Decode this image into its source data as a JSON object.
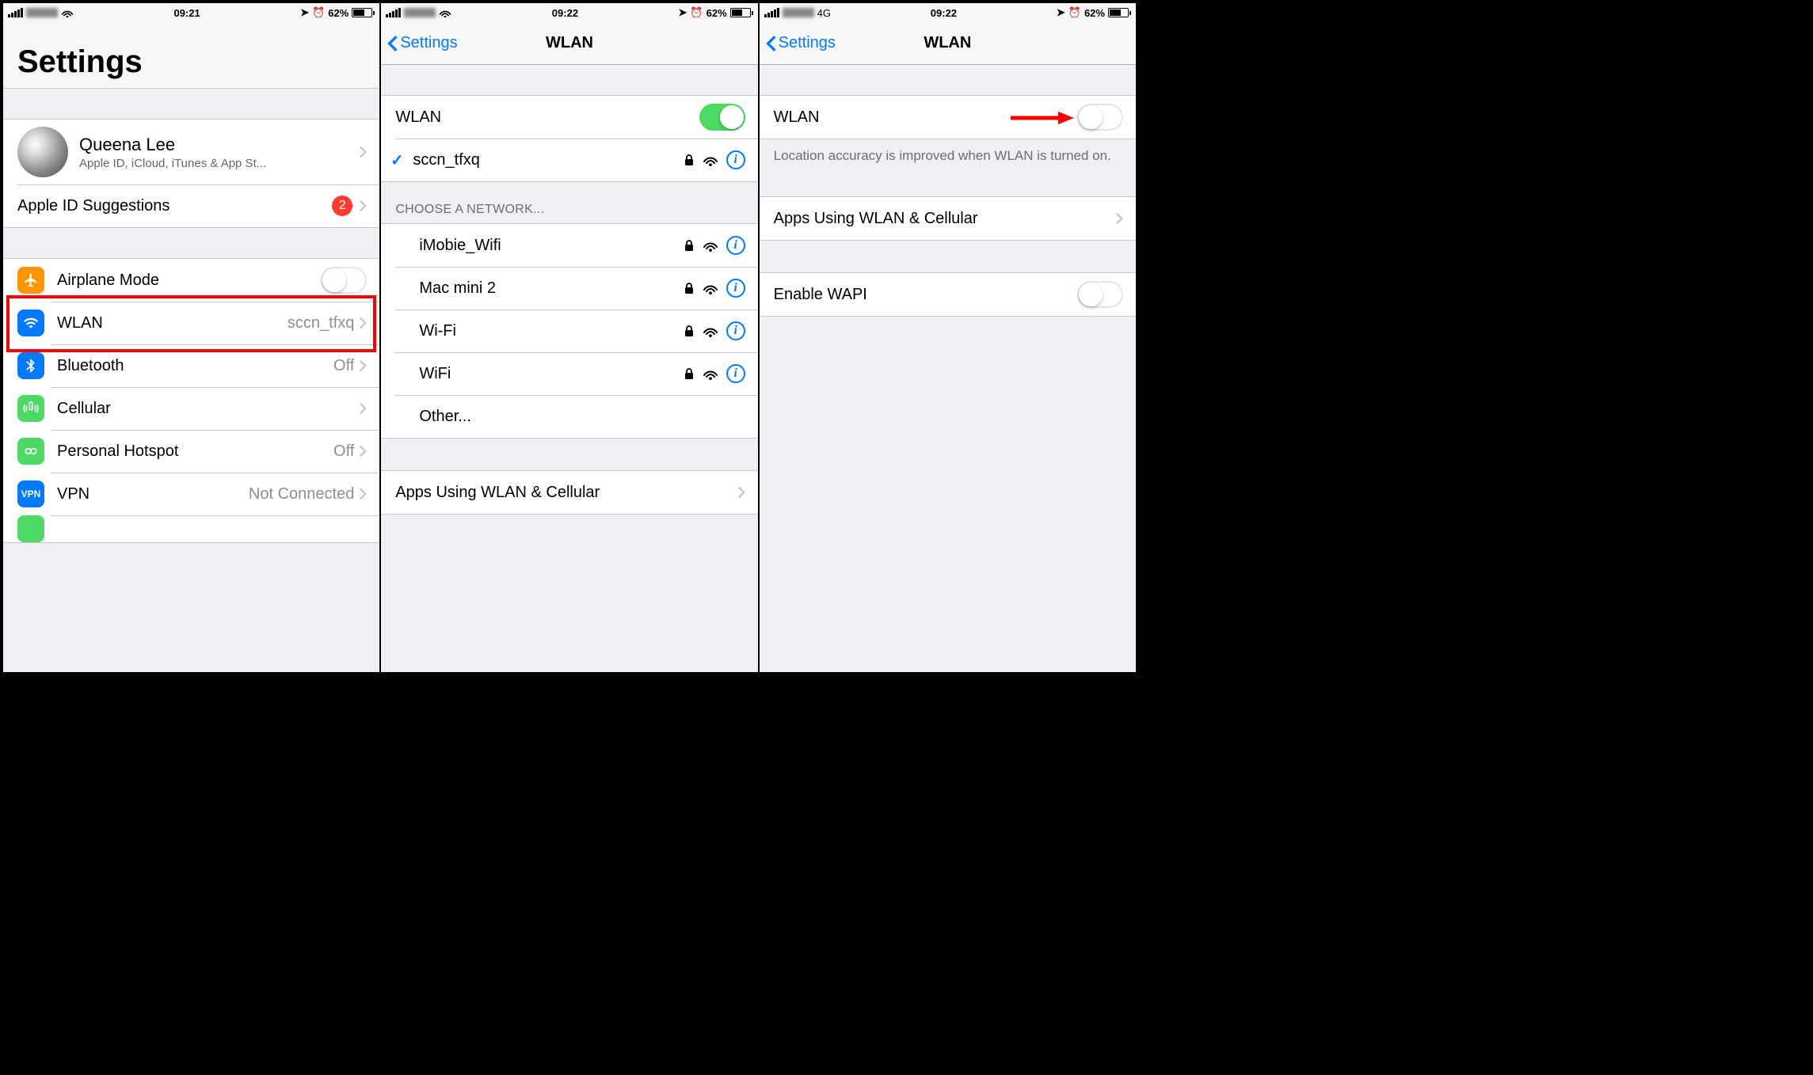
{
  "screen1": {
    "status": {
      "time": "09:21",
      "battery_pct": "62%"
    },
    "title": "Settings",
    "profile": {
      "name": "Queena Lee",
      "subtitle": "Apple ID, iCloud, iTunes & App St..."
    },
    "apple_id_suggestions": {
      "label": "Apple ID Suggestions",
      "badge": "2"
    },
    "rows": {
      "airplane": {
        "label": "Airplane Mode"
      },
      "wlan": {
        "label": "WLAN",
        "detail": "sccn_tfxq"
      },
      "bluetooth": {
        "label": "Bluetooth",
        "detail": "Off"
      },
      "cellular": {
        "label": "Cellular"
      },
      "hotspot": {
        "label": "Personal Hotspot",
        "detail": "Off"
      },
      "vpn": {
        "label": "VPN",
        "detail": "Not Connected"
      }
    }
  },
  "screen2": {
    "status": {
      "time": "09:22",
      "battery_pct": "62%"
    },
    "nav": {
      "back": "Settings",
      "title": "WLAN"
    },
    "wlan_toggle_label": "WLAN",
    "connected": {
      "name": "sccn_tfxq"
    },
    "choose_header": "CHOOSE A NETWORK...",
    "networks": [
      {
        "name": "iMobie_Wifi"
      },
      {
        "name": "Mac mini 2"
      },
      {
        "name": "Wi-Fi"
      },
      {
        "name": "WiFi"
      }
    ],
    "other": "Other...",
    "apps_using": "Apps Using WLAN & Cellular"
  },
  "screen3": {
    "status": {
      "time": "09:22",
      "battery_pct": "62%",
      "carrier_tech": "4G"
    },
    "nav": {
      "back": "Settings",
      "title": "WLAN"
    },
    "wlan_toggle_label": "WLAN",
    "footer": "Location accuracy is improved when WLAN is turned on.",
    "apps_using": "Apps Using WLAN & Cellular",
    "enable_wapi": "Enable WAPI"
  }
}
